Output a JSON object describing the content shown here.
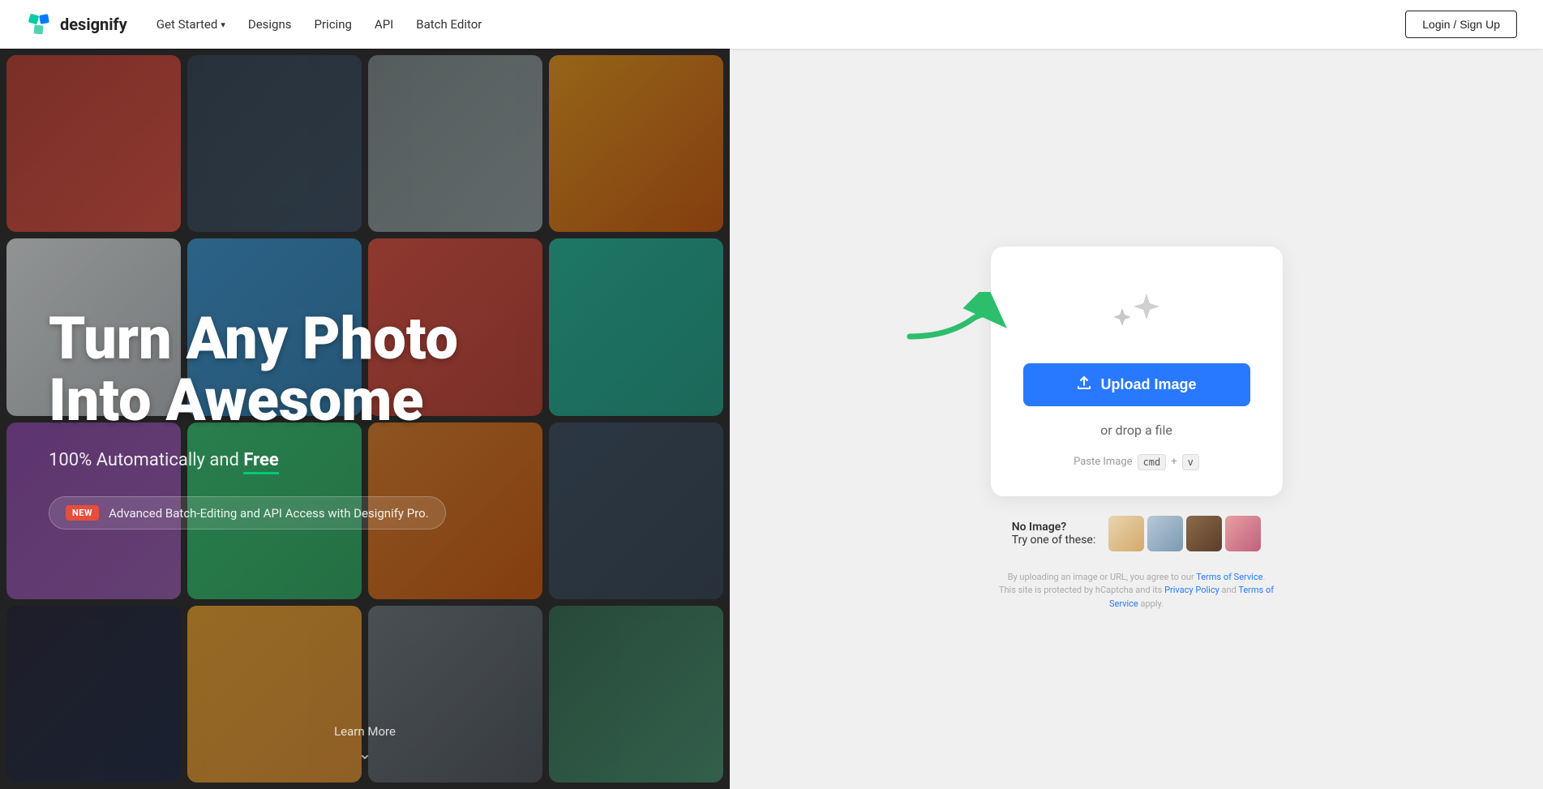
{
  "navbar": {
    "logo_text": "designify",
    "nav_items": [
      {
        "label": "Get Started",
        "has_dropdown": true
      },
      {
        "label": "Designs",
        "has_dropdown": false
      },
      {
        "label": "Pricing",
        "has_dropdown": false
      },
      {
        "label": "API",
        "has_dropdown": false
      },
      {
        "label": "Batch Editor",
        "has_dropdown": false
      }
    ],
    "login_label": "Login / Sign Up"
  },
  "hero": {
    "title_line1": "Turn Any Photo",
    "title_line2": "Into Awesome",
    "subtitle_prefix": "100% Automatically and ",
    "subtitle_free": "Free",
    "new_badge": "NEW",
    "promo_text": "Advanced Batch-Editing and API Access with Designify Pro.",
    "learn_more": "Learn More"
  },
  "upload_panel": {
    "upload_btn_label": "Upload Image",
    "drop_label": "or drop a file",
    "paste_label": "Paste Image",
    "paste_key1": "cmd",
    "paste_key2": "v",
    "sample_label1": "No Image?",
    "sample_label2": "Try one of these:",
    "legal_text": "By uploading an image or URL, you agree to our Terms of Service. This site is protected by hCaptcha and its Privacy Policy and Terms of Service apply.",
    "legal_links": {
      "terms1": "Terms of Service",
      "privacy": "Privacy Policy",
      "terms2": "Terms of Service"
    }
  }
}
